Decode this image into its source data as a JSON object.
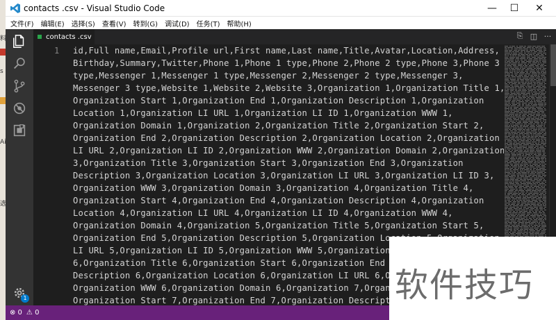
{
  "window": {
    "title": "contacts .csv - Visual Studio Code",
    "controls": {
      "minimize": "—",
      "maximize": "☐",
      "close": "✕"
    }
  },
  "menu": [
    "文件(F)",
    "编辑(E)",
    "选择(S)",
    "查看(V)",
    "转到(G)",
    "调试(D)",
    "任务(T)",
    "帮助(H)"
  ],
  "tab": {
    "label": "contacts .csv"
  },
  "editor": {
    "line_number": "1",
    "lines": [
      "id,Full name,Email,Profile url,First name,Last name,Title,Avatar,Location,Address,",
      "Birthday,Summary,Twitter,Phone 1,Phone 1 type,Phone 2,Phone 2 type,Phone 3,Phone 3",
      "type,Messenger 1,Messenger 1 type,Messenger 2,Messenger 2 type,Messenger 3,",
      "Messenger 3 type,Website 1,Website 2,Website 3,Organization 1,Organization Title 1,",
      "Organization Start 1,Organization End 1,Organization Description 1,Organization",
      "Location 1,Organization LI URL 1,Organization LI ID 1,Organization WWW 1,",
      "Organization Domain 1,Organization 2,Organization Title 2,Organization Start 2,",
      "Organization End 2,Organization Description 2,Organization Location 2,Organization",
      "LI URL 2,Organization LI ID 2,Organization WWW 2,Organization Domain 2,Organization",
      "3,Organization Title 3,Organization Start 3,Organization End 3,Organization",
      "Description 3,Organization Location 3,Organization LI URL 3,Organization LI ID 3,",
      "Organization WWW 3,Organization Domain 3,Organization 4,Organization Title 4,",
      "Organization Start 4,Organization End 4,Organization Description 4,Organization",
      "Location 4,Organization LI URL 4,Organization LI ID 4,Organization WWW 4,",
      "Organization Domain 4,Organization 5,Organization Title 5,Organization Start 5,",
      "Organization End 5,Organization Description 5,Organization Location 5,Organization",
      "LI URL 5,Organization LI ID 5,Organization WWW 5,Organization D",
      "6,Organization Title 6,Organization Start 6,Organization End 6,",
      "Description 6,Organization Location 6,Organization LI URL 6,Or",
      "Organization WWW 6,Organization Domain 6,Organization 7,Organiz",
      "Organization Start 7,Organization End 7,Organization Descriptio"
    ]
  },
  "activity_bar": {
    "icons": [
      "files-icon",
      "search-icon",
      "source-control-icon",
      "debug-icon",
      "extensions-icon"
    ],
    "badge": "1"
  },
  "status": {
    "errors": "⊗ 0",
    "warnings": "⚠ 0"
  },
  "desktop_strip": [
    "料",
    "s",
    "Ai",
    "选"
  ],
  "watermark": {
    "text": "软件技巧"
  },
  "colors": {
    "titlebar": "#ffffff",
    "activity_bar": "#333333",
    "editor_bg": "#1e1e1e",
    "status_bar": "#68217a",
    "tab_dot": "#2aa44a",
    "badge": "#007acc"
  }
}
